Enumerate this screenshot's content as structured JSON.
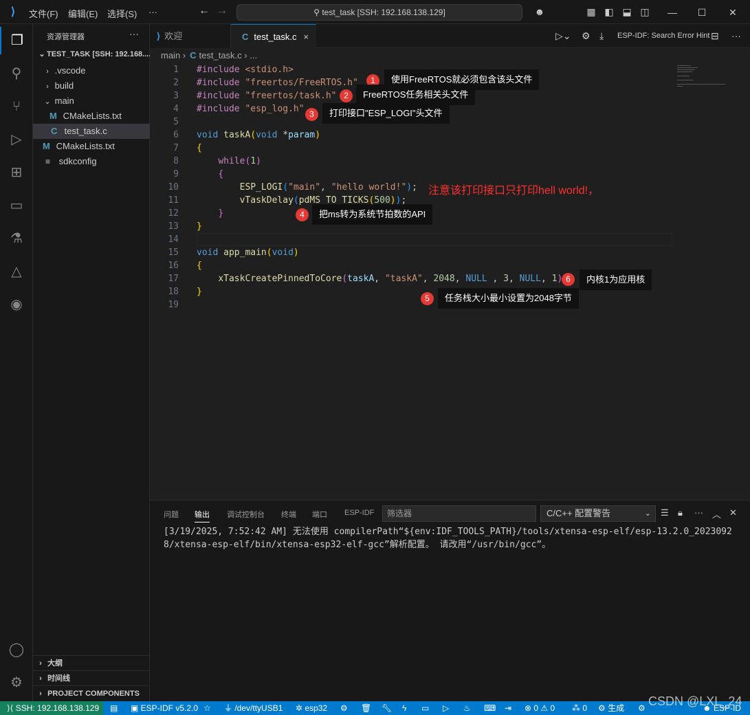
{
  "titlebar": {
    "menu": [
      "文件(F)",
      "编辑(E)",
      "选择(S)",
      "···"
    ],
    "search": "test_task [SSH: 192.168.138.129]"
  },
  "sidebar": {
    "title": "资源管理器",
    "more": "···",
    "root": "TEST_TASK [SSH: 192.168....",
    "items": [
      {
        "label": ".vscode",
        "icon": "chevron-right"
      },
      {
        "label": "build",
        "icon": "chevron-right"
      },
      {
        "label": "main",
        "icon": "chevron-down"
      },
      {
        "label": "CMakeLists.txt",
        "icon": "M"
      },
      {
        "label": "test_task.c",
        "icon": "C"
      },
      {
        "label": "CMakeLists.txt",
        "icon": "M"
      },
      {
        "label": "sdkconfig",
        "icon": "≡"
      }
    ],
    "sections": [
      "大纲",
      "时间线",
      "PROJECT COMPONENTS"
    ]
  },
  "tabs": [
    {
      "label": "欢迎",
      "icon": "vscode-icon"
    },
    {
      "label": "test_task.c",
      "icon": "c-file-icon",
      "close": "×"
    }
  ],
  "toolbar": {
    "esp_hint": "ESP-IDF: Search Error Hint"
  },
  "breadcrumb": {
    "folder": "main",
    "file": "test_task.c",
    "rest": "..."
  },
  "code": {
    "line_numbers": [
      "1",
      "2",
      "3",
      "4",
      "5",
      "6",
      "7",
      "8",
      "9",
      "10",
      "11",
      "12",
      "13",
      "14",
      "15",
      "16",
      "17",
      "18",
      "19"
    ]
  },
  "annotations": [
    {
      "num": "1",
      "text": "使用FreeRTOS就必须包含该头文件"
    },
    {
      "num": "2",
      "text": "FreeRTOS任务相关头文件"
    },
    {
      "num": "3",
      "text": "打印接口\"ESP_LOGI\"头文件"
    },
    {
      "num": "4",
      "text": "把ms转为系统节拍数的API"
    },
    {
      "num": "5",
      "text": "任务栈大小最小设置为2048字节"
    },
    {
      "num": "6",
      "text": "内核1为应用核"
    }
  ],
  "red_note": "注意该打印接口只打印hell world!，",
  "panel": {
    "tabs": [
      "问题",
      "输出",
      "调试控制台",
      "终端",
      "端口",
      "ESP-IDF"
    ],
    "filter_placeholder": "筛选器",
    "dropdown": "C/C++ 配置警告",
    "output": "[3/19/2025, 7:52:42 AM] 无法使用 compilerPath“${env:IDF_TOOLS_PATH}/tools/xtensa-esp-elf/esp-13.2.0_20230928/xtensa-esp-elf/bin/xtensa-esp32-elf-gcc”解析配置。 请改用“/usr/bin/gcc”。"
  },
  "statusbar": {
    "remote": "SSH: 192.168.138.129",
    "idf": "ESP-IDF v5.2.0",
    "port": "/dev/ttyUSB1",
    "target": "esp32",
    "errors": "0",
    "warnings": "0",
    "info": "0",
    "build": "生成",
    "espidf": "ESP-ID"
  },
  "watermark": "CSDN @LXL_24"
}
